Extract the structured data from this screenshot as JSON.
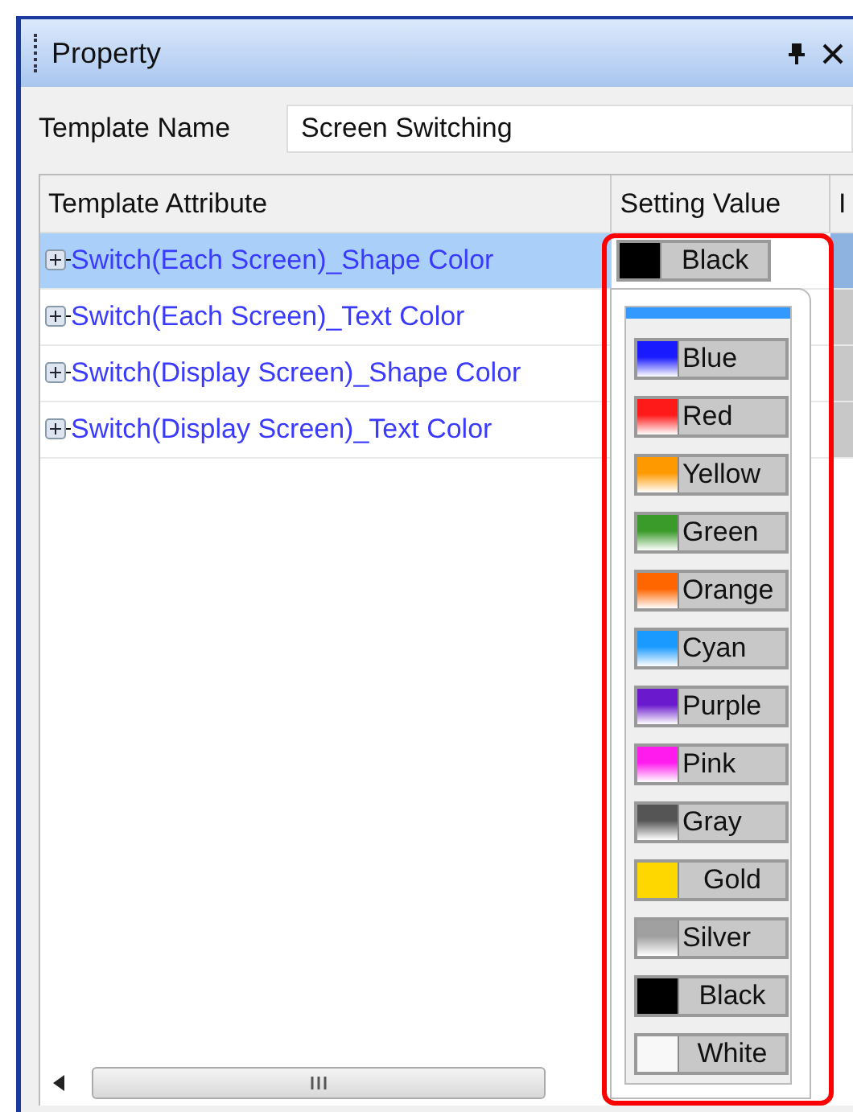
{
  "window": {
    "title": "Property"
  },
  "template_name": {
    "label": "Template Name",
    "value": "Screen Switching"
  },
  "table": {
    "columns": [
      "Template Attribute",
      "Setting Value",
      "I"
    ],
    "rows": [
      {
        "label": "Switch(Each Screen)_Shape Color",
        "selected": true,
        "value": "Black",
        "color": "#000000"
      },
      {
        "label": "Switch(Each Screen)_Text Color",
        "selected": false
      },
      {
        "label": "Switch(Display Screen)_Shape Color",
        "selected": false
      },
      {
        "label": "Switch(Display Screen)_Text Color",
        "selected": false
      }
    ]
  },
  "color_dropdown": {
    "options": [
      {
        "label": "Blue",
        "color": "#1a1aff",
        "kind": "gradient"
      },
      {
        "label": "Red",
        "color": "#ff1a1a",
        "kind": "gradient"
      },
      {
        "label": "Yellow",
        "color": "#ff9900",
        "kind": "gradient"
      },
      {
        "label": "Green",
        "color": "#3a9a2a",
        "kind": "gradient"
      },
      {
        "label": "Orange",
        "color": "#ff6600",
        "kind": "gradient"
      },
      {
        "label": "Cyan",
        "color": "#1a9aff",
        "kind": "gradient"
      },
      {
        "label": "Purple",
        "color": "#6a1acc",
        "kind": "gradient"
      },
      {
        "label": "Pink",
        "color": "#ff1aee",
        "kind": "gradient"
      },
      {
        "label": "Gray",
        "color": "#555555",
        "kind": "gradient"
      },
      {
        "label": "Gold",
        "color": "#ffd700",
        "kind": "flat"
      },
      {
        "label": "Silver",
        "color": "#a0a0a0",
        "kind": "gradient"
      },
      {
        "label": "Black",
        "color": "#000000",
        "kind": "flat"
      },
      {
        "label": "White",
        "color": "#f8f8f8",
        "kind": "flat"
      }
    ]
  }
}
